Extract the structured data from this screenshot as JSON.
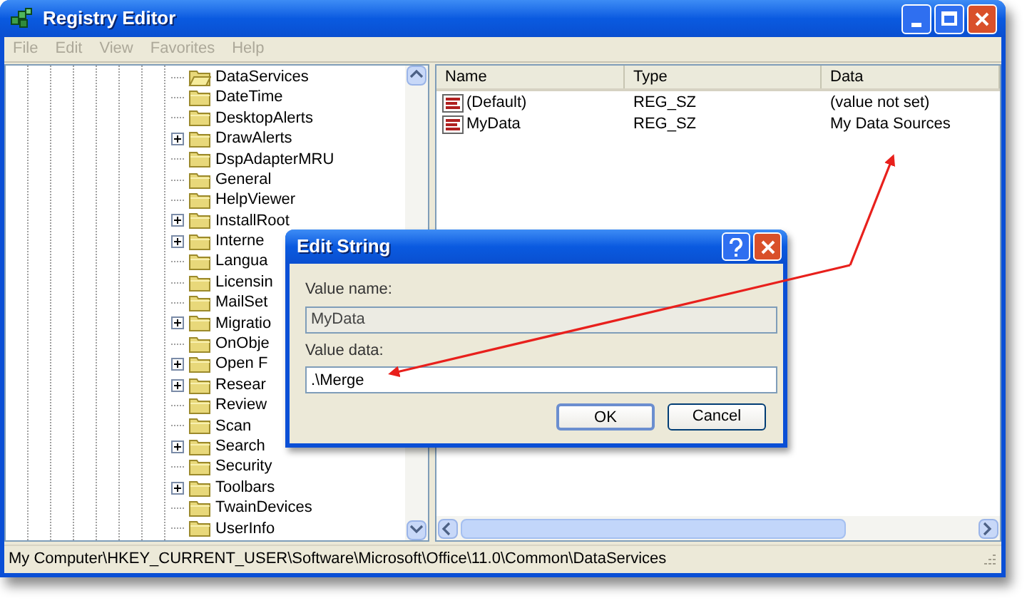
{
  "window": {
    "title": "Registry Editor"
  },
  "menu": [
    {
      "label": "File",
      "disabled": true
    },
    {
      "label": "Edit",
      "disabled": true
    },
    {
      "label": "View",
      "disabled": true
    },
    {
      "label": "Favorites",
      "disabled": true
    },
    {
      "label": "Help",
      "disabled": true
    }
  ],
  "tree": {
    "items": [
      {
        "label": "DataServices",
        "expandable": false,
        "open": true
      },
      {
        "label": "DateTime",
        "expandable": false,
        "open": false
      },
      {
        "label": "DesktopAlerts",
        "expandable": false,
        "open": false
      },
      {
        "label": "DrawAlerts",
        "expandable": true,
        "open": false
      },
      {
        "label": "DspAdapterMRU",
        "expandable": false,
        "open": false
      },
      {
        "label": "General",
        "expandable": false,
        "open": false
      },
      {
        "label": "HelpViewer",
        "expandable": false,
        "open": false
      },
      {
        "label": "InstallRoot",
        "expandable": true,
        "open": false
      },
      {
        "label": "Interne",
        "expandable": true,
        "open": false
      },
      {
        "label": "Langua",
        "expandable": false,
        "open": false
      },
      {
        "label": "Licensin",
        "expandable": false,
        "open": false
      },
      {
        "label": "MailSet",
        "expandable": false,
        "open": false
      },
      {
        "label": "Migratio",
        "expandable": true,
        "open": false
      },
      {
        "label": "OnObje",
        "expandable": false,
        "open": false
      },
      {
        "label": "Open F",
        "expandable": true,
        "open": false
      },
      {
        "label": "Resear",
        "expandable": true,
        "open": false
      },
      {
        "label": "Review",
        "expandable": false,
        "open": false
      },
      {
        "label": "Scan",
        "expandable": false,
        "open": false
      },
      {
        "label": "Search",
        "expandable": true,
        "open": false
      },
      {
        "label": "Security",
        "expandable": false,
        "open": false
      },
      {
        "label": "Toolbars",
        "expandable": true,
        "open": false
      },
      {
        "label": "TwainDevices",
        "expandable": false,
        "open": false
      },
      {
        "label": "UserInfo",
        "expandable": false,
        "open": false
      }
    ]
  },
  "values": {
    "columns": [
      "Name",
      "Type",
      "Data"
    ],
    "rows": [
      {
        "name": "(Default)",
        "type": "REG_SZ",
        "data": "(value not set)"
      },
      {
        "name": "MyData",
        "type": "REG_SZ",
        "data": "My Data Sources"
      }
    ]
  },
  "dialog": {
    "title": "Edit String",
    "fields": [
      {
        "label": "Value name:",
        "value": "MyData",
        "disabled": true
      },
      {
        "label": "Value data:",
        "value": ".\\Merge",
        "disabled": false
      }
    ],
    "buttons": [
      {
        "label": "OK",
        "default": true
      },
      {
        "label": "Cancel",
        "default": false
      }
    ]
  },
  "status_bar": "My Computer\\HKEY_CURRENT_USER\\Software\\Microsoft\\Office\\11.0\\Common\\DataServices"
}
